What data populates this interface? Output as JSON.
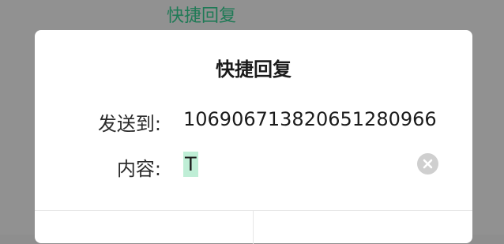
{
  "background": {
    "screen_title": "快捷回复"
  },
  "dialog": {
    "title": "快捷回复",
    "to_label": "发送到:",
    "to_value": "106906713820651280966",
    "content_label": "内容:",
    "content_value": "T"
  },
  "actions": {
    "left_label": "",
    "right_label": ""
  },
  "colors": {
    "accent": "#1f7a56",
    "overlay": "#919191",
    "selection": "#bfeed6"
  },
  "icons": {
    "clear": "clear-circle-x-icon"
  }
}
